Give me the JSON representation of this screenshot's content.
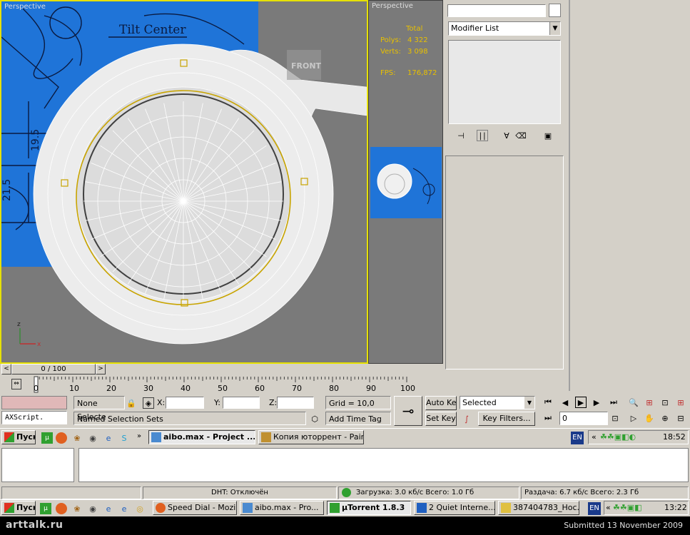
{
  "viewport_main": {
    "label": "Perspective",
    "blueprint_title": "Tilt Center",
    "dims": [
      "19.5",
      "21.5"
    ],
    "cube_label": "FRONT",
    "axis_z": "z",
    "axis_x": "x"
  },
  "viewport_small": {
    "label": "Perspective",
    "stats_header": "Total",
    "polys_label": "Polys:",
    "polys_value": "4 322",
    "verts_label": "Verts:",
    "verts_value": "3 098",
    "fps_label": "FPS:",
    "fps_value": "176,872"
  },
  "command_panel": {
    "modifier_list": "Modifier List"
  },
  "timeline": {
    "frame_counter": "0 / 100",
    "ticks": [
      "0",
      "10",
      "20",
      "30",
      "40",
      "50",
      "60",
      "70",
      "80",
      "90",
      "100"
    ]
  },
  "status": {
    "maxscript": "AXScript.",
    "selection": "None Selecte",
    "named_sets": "Named Selection Sets",
    "x_label": "X:",
    "y_label": "Y:",
    "z_label": "Z:",
    "grid": "Grid = 10,0",
    "add_time_tag": "Add Time Tag",
    "auto_key": "Auto Key",
    "set_key": "Set Key",
    "selected_option": "Selected",
    "key_filters": "Key Filters...",
    "frame_value": "0"
  },
  "taskbar1": {
    "start": "Пуск",
    "tasks": [
      "aibo.max - Project ...",
      "Копия юторрент - Paint"
    ],
    "lang": "EN",
    "time": "18:52"
  },
  "utorrent_status": {
    "dht": "DHT: Отключён",
    "download": "Загрузка: 3.0 кб/с Всего: 1.0 Гб",
    "upload": "Раздача: 6.7 кб/с Всего: 2.3 Гб"
  },
  "taskbar2": {
    "start": "Пуск",
    "tasks": [
      "Speed Dial - Mozil...",
      "aibo.max - Pro...",
      "µTorrent 1.8.3",
      "2 Quiet Interne...",
      "387404783_Hoc..."
    ],
    "lang": "EN",
    "time": "13:22"
  },
  "footer": {
    "logo": "arttalk.ru",
    "submitted": "Submitted 13 November 2009"
  }
}
